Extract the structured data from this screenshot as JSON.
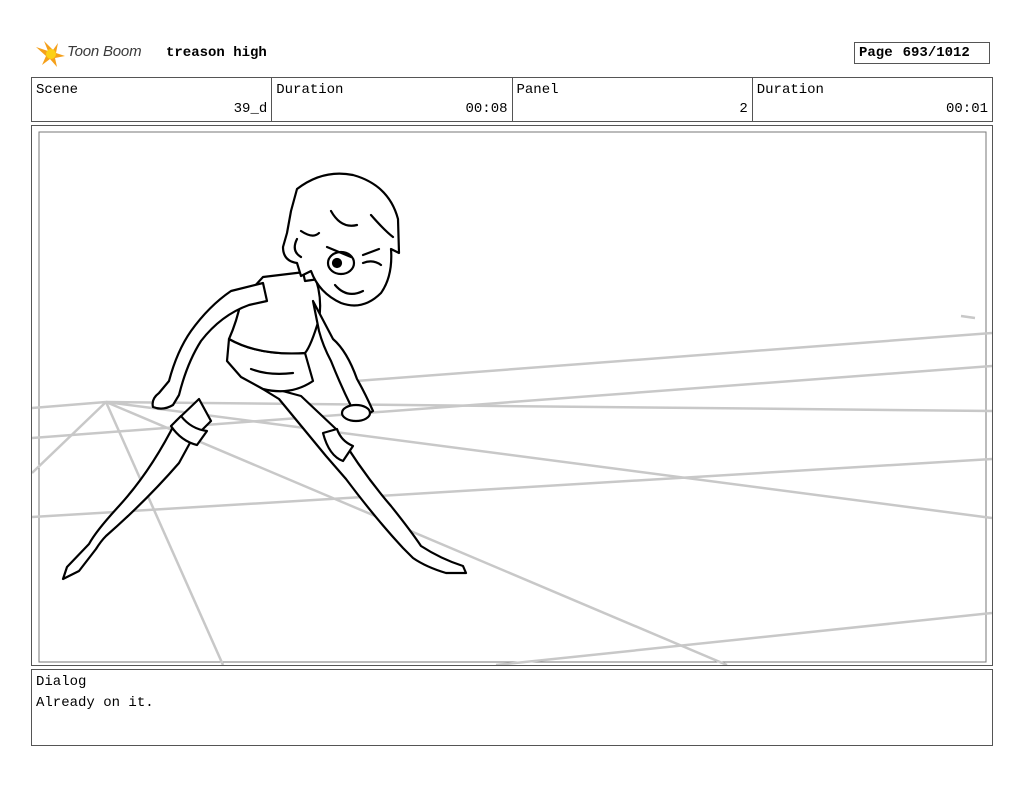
{
  "header": {
    "logo_text": "Toon Boom",
    "logo_icon": "toon-boom-star-burst",
    "project_title": "treason high",
    "page_label": "Page",
    "page_value": "693/1012"
  },
  "info": {
    "scene_label": "Scene",
    "scene_value": "39_d",
    "scene_duration_label": "Duration",
    "scene_duration_value": "00:08",
    "panel_label": "Panel",
    "panel_value": "2",
    "panel_duration_label": "Duration",
    "panel_duration_value": "00:01"
  },
  "panel": {
    "drawing": "line-art of a teen character in a wide lunging stance with perspective guide lines"
  },
  "dialog": {
    "label": "Dialog",
    "text": "Already on it."
  },
  "colors": {
    "logo_orange": "#f5a01a",
    "logo_yellow": "#fcd116",
    "border": "#555555",
    "guide_lines": "#c8c8c8"
  }
}
